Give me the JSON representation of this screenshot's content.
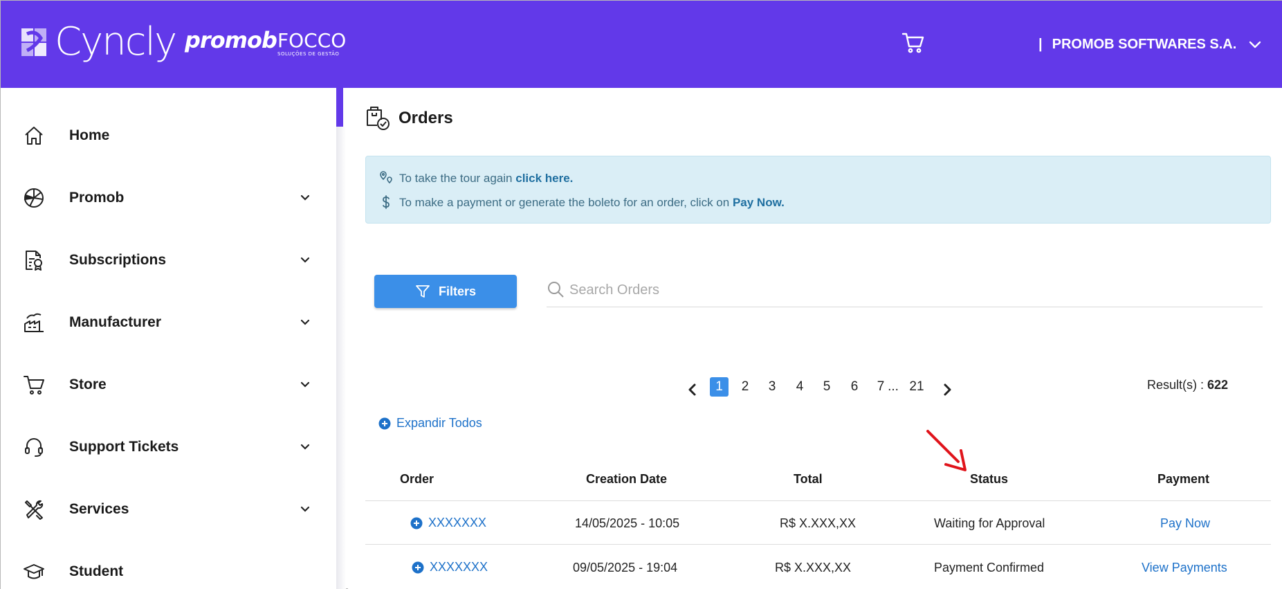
{
  "header": {
    "brand": "Cyncly",
    "promob_logo": "promob",
    "focco_logo": "FOCCO",
    "focco_tagline": "SOLUÇÕES DE GESTÃO",
    "company_separator": "|",
    "company_name": "PROMOB SOFTWARES S.A.",
    "accent_color": "#6239e9"
  },
  "sidebar": {
    "items": [
      {
        "label": "Home",
        "icon": "home-icon",
        "has_chevron": false
      },
      {
        "label": "Promob",
        "icon": "promob-icon",
        "has_chevron": true
      },
      {
        "label": "Subscriptions",
        "icon": "subscriptions-icon",
        "has_chevron": true
      },
      {
        "label": "Manufacturer",
        "icon": "factory-icon",
        "has_chevron": true
      },
      {
        "label": "Store",
        "icon": "cart-icon",
        "has_chevron": true
      },
      {
        "label": "Support Tickets",
        "icon": "headset-icon",
        "has_chevron": true
      },
      {
        "label": "Services",
        "icon": "tools-icon",
        "has_chevron": true
      },
      {
        "label": "Student",
        "icon": "graduation-cap-icon",
        "has_chevron": false
      }
    ]
  },
  "main": {
    "title": "Orders",
    "info": {
      "line1_text": "To take the tour again ",
      "line1_link": "click here.",
      "line2_text": "To make a payment or generate the boleto for an order, click on ",
      "line2_link": "Pay Now."
    },
    "filters_label": "Filters",
    "search_placeholder": "Search Orders",
    "pagination": {
      "pages": [
        "1",
        "2",
        "3",
        "4",
        "5",
        "6",
        "7",
        "...",
        "21"
      ],
      "active": "1"
    },
    "result_label": "Result(s) : ",
    "result_count": "622",
    "expand_all": "Expandir Todos",
    "table": {
      "columns": [
        "Order",
        "Creation Date",
        "Total",
        "Status",
        "Payment"
      ],
      "rows": [
        {
          "order": "XXXXXXX",
          "date": "14/05/2025 - 10:05",
          "total": "R$ X.XXX,XX",
          "status": "Waiting for Approval",
          "payment": "Pay Now"
        },
        {
          "order": "XXXXXXX",
          "date": "09/05/2025 - 19:04",
          "total": "R$ X.XXX,XX",
          "status": "Payment Confirmed",
          "payment": "View Payments"
        }
      ]
    },
    "link_color": "#1d71c9",
    "button_color": "#3b8fe8",
    "annotation_color": "#e0141b"
  }
}
